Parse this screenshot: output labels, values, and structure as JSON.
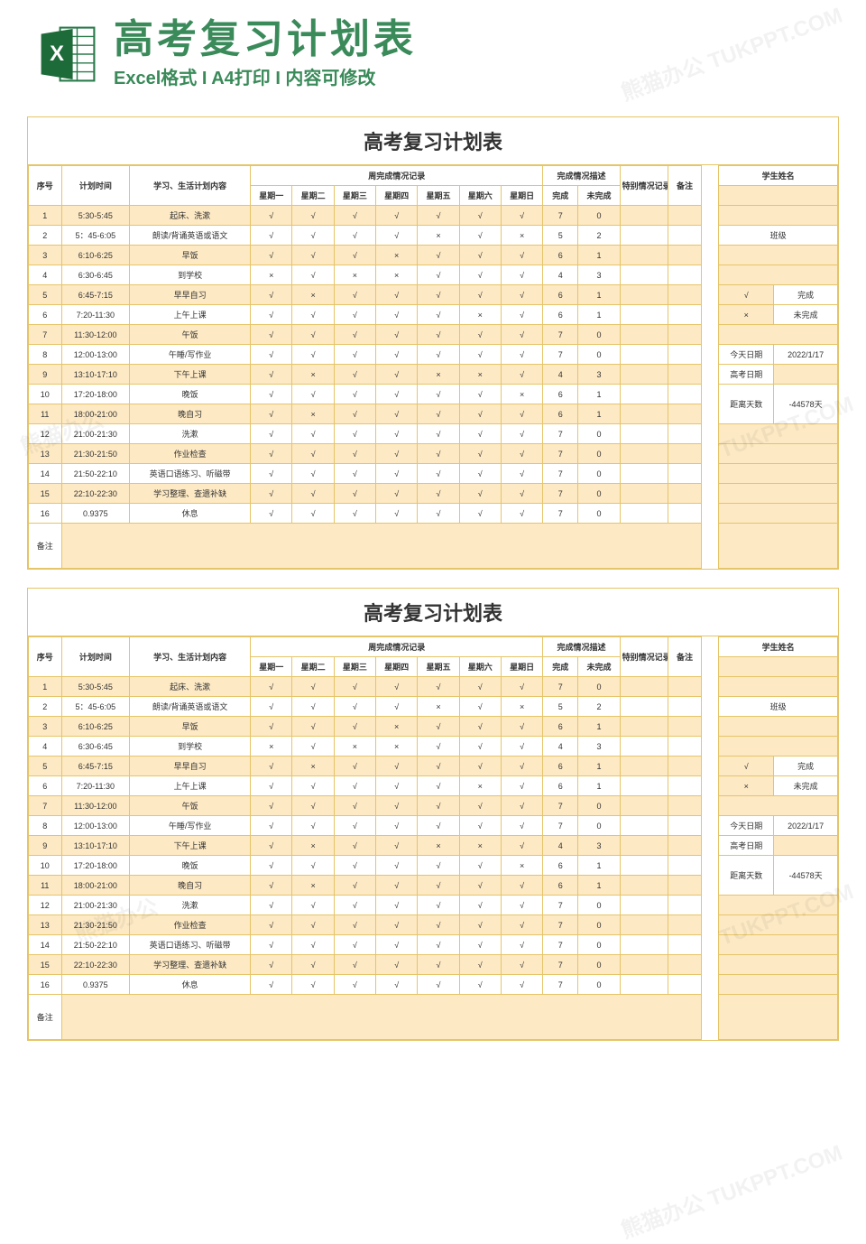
{
  "header": {
    "title": "高考复习计划表",
    "subtitle": "Excel格式 I A4打印 I 内容可修改"
  },
  "watermarks": {
    "top_right": "熊猫办公 TUKPPT.COM",
    "mid_left": "熊猫办公",
    "mid_right": "TUKPPT.COM"
  },
  "sheet": {
    "title": "高考复习计划表",
    "headers": {
      "seq": "序号",
      "plan_time": "计划时间",
      "content": "学习、生活计划内容",
      "week_record": "周完成情况记录",
      "days": [
        "星期一",
        "星期二",
        "星期三",
        "星期四",
        "星期五",
        "星期六",
        "星期日"
      ],
      "complete_desc": "完成情况描述",
      "done": "完成",
      "undone": "未完成",
      "special": "特别情况记录",
      "remark": "备注",
      "student_name": "学生姓名",
      "class": "班级",
      "done_label": "完成",
      "undone_label": "未完成",
      "today": "今天日期",
      "today_val": "2022/1/17",
      "exam_date": "高考日期",
      "days_left": "距离天数",
      "days_left_val": "-44578天"
    },
    "rows": [
      {
        "n": "1",
        "t": "5:30-5:45",
        "c": "起床、洗漱",
        "d": [
          "√",
          "√",
          "√",
          "√",
          "√",
          "√",
          "√"
        ],
        "done": "7",
        "undone": "0",
        "f": true
      },
      {
        "n": "2",
        "t": "5：45-6:05",
        "c": "朗读/背诵英语或语文",
        "d": [
          "√",
          "√",
          "√",
          "√",
          "×",
          "√",
          "×"
        ],
        "done": "5",
        "undone": "2",
        "f": false
      },
      {
        "n": "3",
        "t": "6:10-6:25",
        "c": "早饭",
        "d": [
          "√",
          "√",
          "√",
          "×",
          "√",
          "√",
          "√"
        ],
        "done": "6",
        "undone": "1",
        "f": true
      },
      {
        "n": "4",
        "t": "6:30-6:45",
        "c": "到学校",
        "d": [
          "×",
          "√",
          "×",
          "×",
          "√",
          "√",
          "√"
        ],
        "done": "4",
        "undone": "3",
        "f": false
      },
      {
        "n": "5",
        "t": "6:45-7:15",
        "c": "早早自习",
        "d": [
          "√",
          "×",
          "√",
          "√",
          "√",
          "√",
          "√"
        ],
        "done": "6",
        "undone": "1",
        "f": true
      },
      {
        "n": "6",
        "t": "7:20-11:30",
        "c": "上午上课",
        "d": [
          "√",
          "√",
          "√",
          "√",
          "√",
          "×",
          "√"
        ],
        "done": "6",
        "undone": "1",
        "f": false
      },
      {
        "n": "7",
        "t": "11:30-12:00",
        "c": "午饭",
        "d": [
          "√",
          "√",
          "√",
          "√",
          "√",
          "√",
          "√"
        ],
        "done": "7",
        "undone": "0",
        "f": true
      },
      {
        "n": "8",
        "t": "12:00-13:00",
        "c": "午睡/写作业",
        "d": [
          "√",
          "√",
          "√",
          "√",
          "√",
          "√",
          "√"
        ],
        "done": "7",
        "undone": "0",
        "f": false
      },
      {
        "n": "9",
        "t": "13:10-17:10",
        "c": "下午上课",
        "d": [
          "√",
          "×",
          "√",
          "√",
          "×",
          "×",
          "√"
        ],
        "done": "4",
        "undone": "3",
        "f": true
      },
      {
        "n": "10",
        "t": "17:20-18:00",
        "c": "晚饭",
        "d": [
          "√",
          "√",
          "√",
          "√",
          "√",
          "√",
          "×"
        ],
        "done": "6",
        "undone": "1",
        "f": false
      },
      {
        "n": "11",
        "t": "18:00-21:00",
        "c": "晚自习",
        "d": [
          "√",
          "×",
          "√",
          "√",
          "√",
          "√",
          "√"
        ],
        "done": "6",
        "undone": "1",
        "f": true
      },
      {
        "n": "12",
        "t": "21:00-21:30",
        "c": "洗漱",
        "d": [
          "√",
          "√",
          "√",
          "√",
          "√",
          "√",
          "√"
        ],
        "done": "7",
        "undone": "0",
        "f": false
      },
      {
        "n": "13",
        "t": "21:30-21:50",
        "c": "作业检查",
        "d": [
          "√",
          "√",
          "√",
          "√",
          "√",
          "√",
          "√"
        ],
        "done": "7",
        "undone": "0",
        "f": true
      },
      {
        "n": "14",
        "t": "21:50-22:10",
        "c": "英语口语练习、听磁带",
        "d": [
          "√",
          "√",
          "√",
          "√",
          "√",
          "√",
          "√"
        ],
        "done": "7",
        "undone": "0",
        "f": false
      },
      {
        "n": "15",
        "t": "22:10-22:30",
        "c": "学习整理、查遗补缺",
        "d": [
          "√",
          "√",
          "√",
          "√",
          "√",
          "√",
          "√"
        ],
        "done": "7",
        "undone": "0",
        "f": true
      },
      {
        "n": "16",
        "t": "0.9375",
        "c": "休息",
        "d": [
          "√",
          "√",
          "√",
          "√",
          "√",
          "√",
          "√"
        ],
        "done": "7",
        "undone": "0",
        "f": false
      }
    ],
    "remark_label": "备注"
  },
  "marks": {
    "tick": "√",
    "cross": "×"
  }
}
